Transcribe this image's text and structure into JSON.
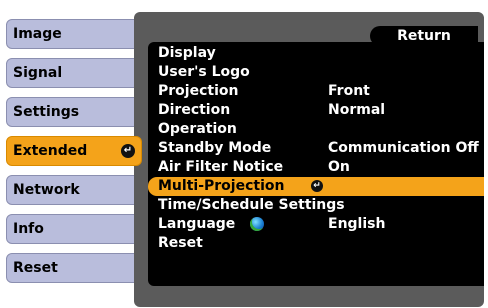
{
  "sidebar": {
    "items": [
      {
        "label": "Image"
      },
      {
        "label": "Signal"
      },
      {
        "label": "Settings"
      },
      {
        "label": "Extended",
        "active": true
      },
      {
        "label": "Network"
      },
      {
        "label": "Info"
      },
      {
        "label": "Reset"
      }
    ]
  },
  "panel": {
    "return_label": "Return",
    "items": [
      {
        "label": "Display",
        "value": ""
      },
      {
        "label": "User's Logo",
        "value": ""
      },
      {
        "label": "Projection",
        "value": "Front"
      },
      {
        "label": "Direction",
        "value": "Normal"
      },
      {
        "label": "Operation",
        "value": ""
      },
      {
        "label": "Standby Mode",
        "value": "Communication Off"
      },
      {
        "label": "Air Filter Notice",
        "value": "On"
      },
      {
        "label": "Multi-Projection",
        "value": "",
        "selected": true
      },
      {
        "label": "Time/Schedule Settings",
        "value": ""
      },
      {
        "label": "Language",
        "value": "English",
        "icon": "globe-icon"
      },
      {
        "label": "Reset",
        "value": ""
      }
    ]
  },
  "icons": {
    "enter": "enter-icon",
    "language": "globe-icon"
  },
  "colors": {
    "sidebar_button": "#b9bddc",
    "highlight": "#f4a31a",
    "panel_frame": "#5b5b5b",
    "menu_background": "#000000"
  }
}
